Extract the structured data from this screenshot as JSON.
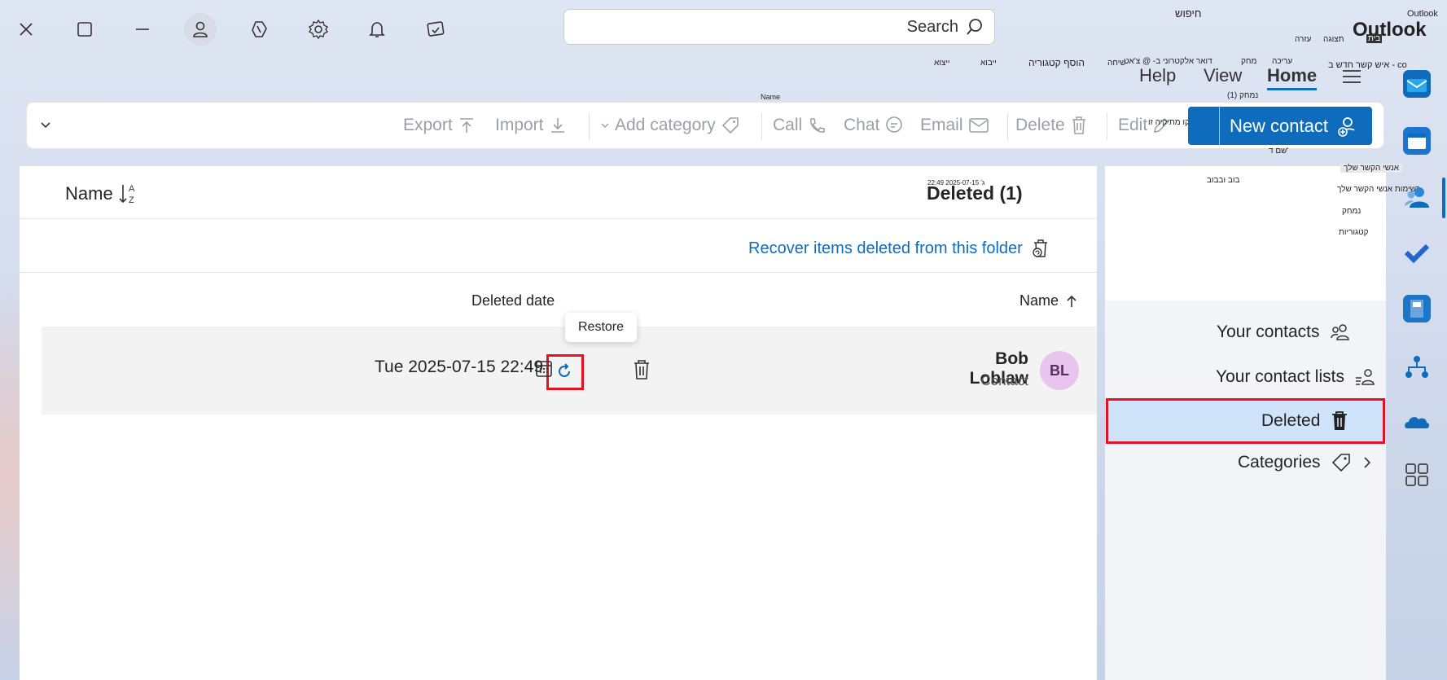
{
  "app": {
    "brand_small": "Outlook",
    "brand": "Outlook",
    "brand_overlay": "בית",
    "title_hebrew": "חיפוש",
    "menu_hebrew": [
      "תצוגה",
      "עזרה"
    ],
    "new_contact_hebrew": "איש קשר חדש ב - co"
  },
  "titlebar": {
    "close": "close-icon",
    "maximize": "maximize-icon",
    "minimize": "minimize-icon"
  },
  "search": {
    "placeholder": "Search",
    "value": ""
  },
  "ribbon": {
    "tabs": [
      "Home",
      "View",
      "Help"
    ],
    "active_tab": "Home",
    "hebrew_labels": {
      "edit": "עריכה",
      "delete": "מחק",
      "email_chat": "דואר אלקטרוני ב- @ צ'אט",
      "call": "שיחה",
      "add_category": "הוסף קטגוריה",
      "import": "ייבוא",
      "export": "ייצוא",
      "name_tooltip": "Name",
      "deleted_count": "נמחק (1)",
      "recover_tip": "שחזור פריטים שנמחקו מתיקיה זו",
      "sort_hint": "שם ד'"
    },
    "commands": {
      "new_contact": "New contact",
      "edit": "Edit",
      "delete": "Delete",
      "email": "Email",
      "chat": "Chat",
      "call": "Call",
      "add_category": "Add category",
      "import": "Import",
      "export": "Export"
    }
  },
  "list": {
    "folder_title": "Deleted (1)",
    "timestamp_small": "ג' 2025-07-15 22:49",
    "sort_label": "Name",
    "recover_link": "Recover items deleted from this folder",
    "col_name": "Name",
    "col_deleted_date": "Deleted date",
    "tooltip": "Restore",
    "rows": [
      {
        "initials": "BL",
        "name": "Bob Loblaw",
        "type": "Contact",
        "date": "Tue 2025-07-15 22:49"
      }
    ]
  },
  "nav": {
    "hebrew_items": [
      "אנשי הקשר שלך",
      "בוב ובבוב",
      "רשימות אנשי הקשר שלך",
      "נמחק",
      "קטגוריות"
    ],
    "items": [
      {
        "label": "Your contacts",
        "icon": "people-icon"
      },
      {
        "label": "Your contact lists",
        "icon": "people-list-icon"
      },
      {
        "label": "Deleted",
        "icon": "trash-icon",
        "selected": true
      },
      {
        "label": "Categories",
        "icon": "tag-icon"
      }
    ]
  },
  "colors": {
    "accent": "#0f6cbd",
    "selected_nav": "#cfe4fa",
    "highlight_box": "#e81123",
    "avatar_bg": "#e8c5ee"
  }
}
